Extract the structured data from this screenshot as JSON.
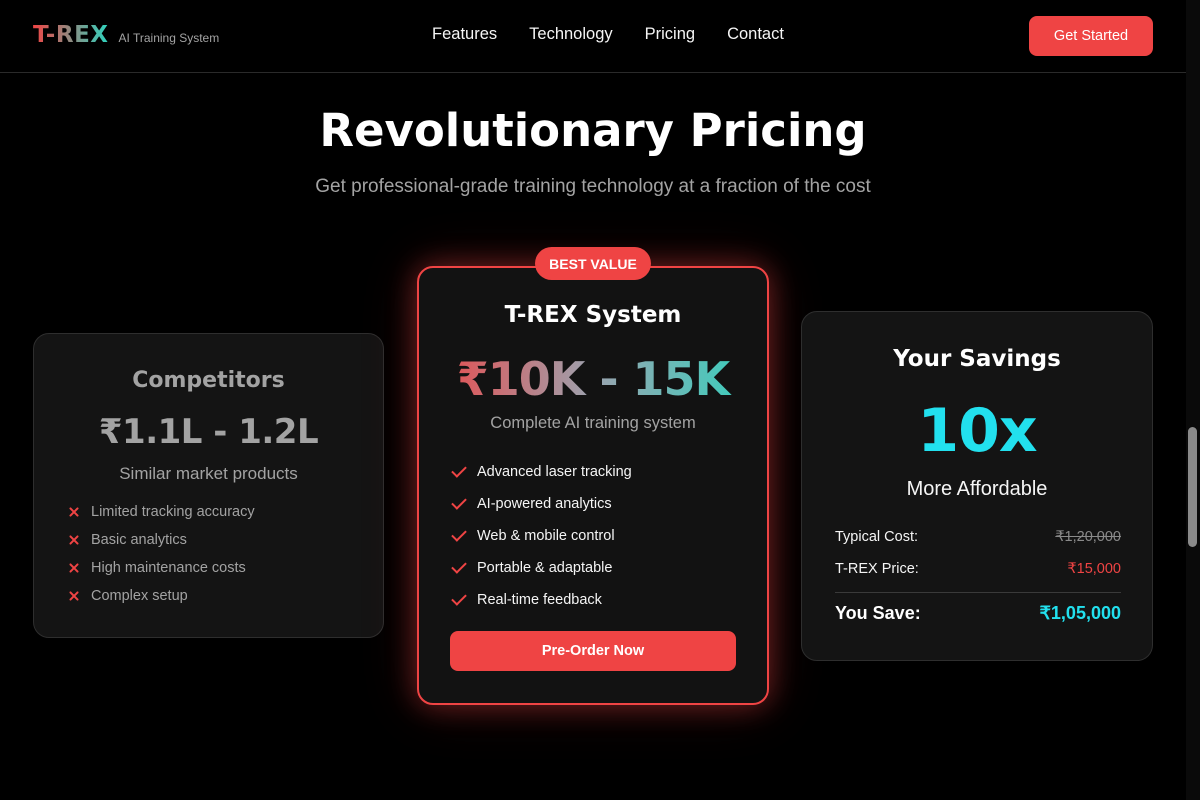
{
  "nav": {
    "logo": "T-REX",
    "tagline": "AI Training System",
    "links": [
      "Features",
      "Technology",
      "Pricing",
      "Contact"
    ],
    "cta": "Get Started"
  },
  "hero": {
    "title": "Revolutionary Pricing",
    "subtitle": "Get professional-grade training technology at a fraction of the cost"
  },
  "competitors": {
    "title": "Competitors",
    "price": "₹1.1L - 1.2L",
    "description": "Similar market products",
    "items": [
      "Limited tracking accuracy",
      "Basic analytics",
      "High maintenance costs",
      "Complex setup"
    ]
  },
  "trex": {
    "badge": "BEST VALUE",
    "title": "T-REX System",
    "price": "₹10K - 15K",
    "description": "Complete AI training system",
    "items": [
      "Advanced laser tracking",
      "AI-powered analytics",
      "Web & mobile control",
      "Portable & adaptable",
      "Real-time feedback"
    ],
    "button": "Pre-Order Now"
  },
  "savings": {
    "title": "Your Savings",
    "multiplier": "10x",
    "subtitle": "More Affordable",
    "typical_label": "Typical Cost:",
    "typical_value": "₹1,20,000",
    "trex_label": "T-REX Price:",
    "trex_value": "₹15,000",
    "save_label": "You Save:",
    "save_value": "₹1,05,000"
  },
  "colors": {
    "accent": "#ef4444",
    "cyan": "#22e0ee",
    "background": "#000000",
    "card": "#141414"
  }
}
